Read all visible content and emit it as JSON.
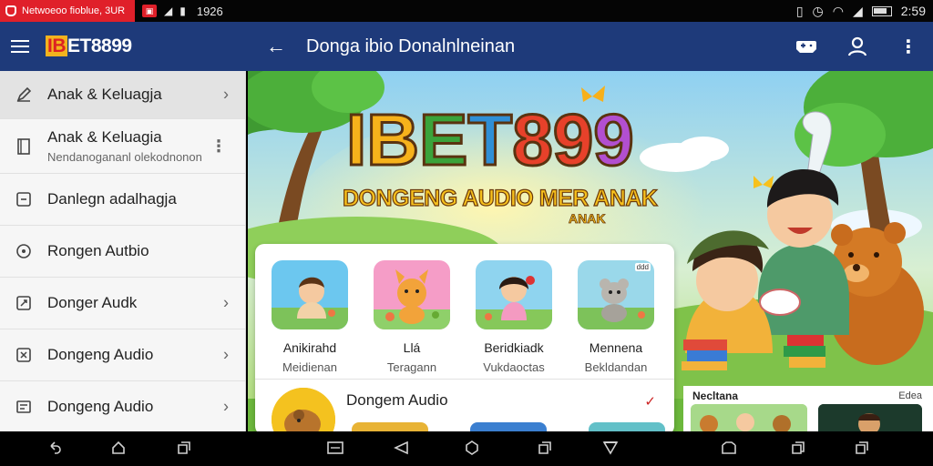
{
  "status_bar": {
    "notification_text": "Netwoeoo fioblue, 3UR",
    "time_center": "1926",
    "time_right": "2:59"
  },
  "app": {
    "brand_lead": "IB",
    "brand_rest": "ET8899",
    "screen_title": "Donga ibio Donalnlneinan"
  },
  "drawer": {
    "items": [
      {
        "label": "Anak & Keluagja",
        "sub": "",
        "icon": "edit-icon",
        "trailing": "chevron"
      },
      {
        "label": "Anak & Keluagia",
        "sub": "Nendanogananl olekodnonon",
        "icon": "book-icon",
        "trailing": "kebab"
      },
      {
        "label": "Danlegn adalhagja",
        "sub": "",
        "icon": "square-icon",
        "trailing": ""
      },
      {
        "label": "Rongen Autbio",
        "sub": "",
        "icon": "disc-icon",
        "trailing": ""
      },
      {
        "label": "Donger Audk",
        "sub": "",
        "icon": "puzzle-icon",
        "trailing": "chevron"
      },
      {
        "label": "Dongeng Audio",
        "sub": "",
        "icon": "shuffle-icon",
        "trailing": "chevron"
      },
      {
        "label": "Dongeng Audio",
        "sub": "",
        "icon": "list-icon",
        "trailing": "chevron"
      }
    ]
  },
  "hero": {
    "title_letters": [
      "I",
      "B",
      "E",
      "T",
      "8",
      "9",
      "9"
    ],
    "title_colors": [
      "#f6b21b",
      "#f6b21b",
      "#3aa33a",
      "#2f8fd6",
      "#e7412a",
      "#e7412a",
      "#b24fd0"
    ],
    "subtitle": "DONGENG AUDIO MER ANAK",
    "subtitle_small": "ANAK"
  },
  "card": {
    "tiles": [
      {
        "title": "Anikirahd",
        "sub": "Meidienan",
        "bg": "#6cc7ef"
      },
      {
        "title": "Llá",
        "sub": "Teragann",
        "bg": "#f59dc7"
      },
      {
        "title": "Beridkiadk",
        "sub": "Vukdaoctas",
        "bg": "#8fd4ef"
      },
      {
        "title": "Mennena",
        "sub": "Bekldandan",
        "bg": "#9ad8ea"
      }
    ],
    "tile_badge": "ddd",
    "section_title": "Dongem Audio",
    "section_check": "✓"
  },
  "preview": {
    "heading": "Necltana",
    "more": "Edea"
  }
}
